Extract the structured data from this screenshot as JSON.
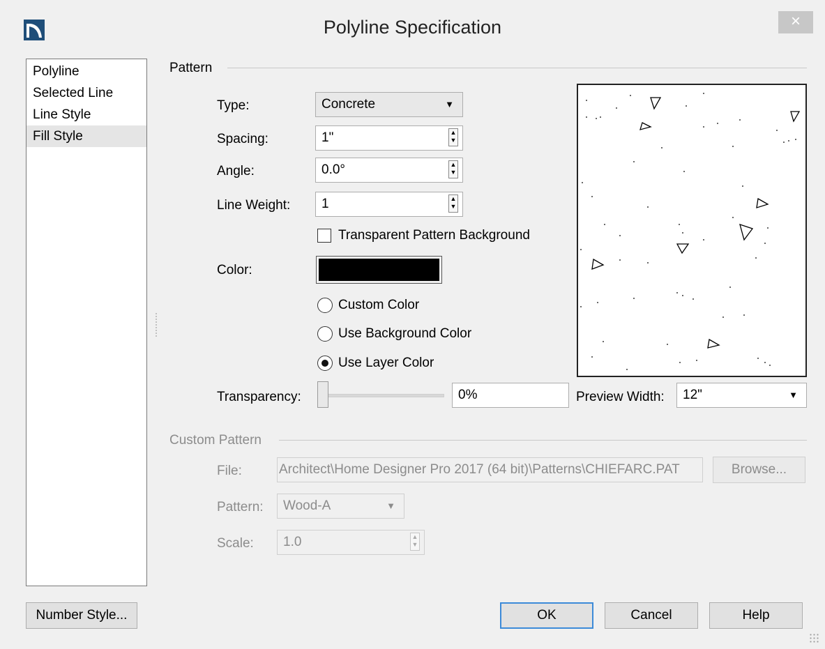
{
  "window": {
    "title": "Polyline Specification",
    "close_label": "×"
  },
  "nav": {
    "items": [
      {
        "label": "Polyline"
      },
      {
        "label": "Selected Line"
      },
      {
        "label": "Line Style"
      },
      {
        "label": "Fill Style",
        "selected": true
      }
    ]
  },
  "pattern": {
    "section_label": "Pattern",
    "type_label": "Type:",
    "type_value": "Concrete",
    "spacing_label": "Spacing:",
    "spacing_value": "1\"",
    "angle_label": "Angle:",
    "angle_value": "0.0°",
    "line_weight_label": "Line Weight:",
    "line_weight_value": "1",
    "transparent_bg_label": "Transparent Pattern Background",
    "transparent_bg_checked": false,
    "color_label": "Color:",
    "color_value": "#000000",
    "radio_custom_label": "Custom Color",
    "radio_background_label": "Use Background Color",
    "radio_layer_label": "Use Layer Color",
    "selected_color_option": "Use Layer Color",
    "transparency_label": "Transparency:",
    "transparency_value": "0%",
    "transparency_level": 0,
    "preview_width_label": "Preview Width:",
    "preview_width_value": "12\""
  },
  "custom_pattern": {
    "section_label": "Custom Pattern",
    "file_label": "File:",
    "file_value": "Architect\\Home Designer Pro 2017 (64 bit)\\Patterns\\CHIEFARC.PAT",
    "browse_label": "Browse...",
    "pattern_label": "Pattern:",
    "pattern_value": "Wood-A",
    "scale_label": "Scale:",
    "scale_value": "1.0"
  },
  "footer": {
    "number_style_label": "Number Style...",
    "ok_label": "OK",
    "cancel_label": "Cancel",
    "help_label": "Help"
  },
  "icons": {
    "app": "chief-architect-logo-icon",
    "close": "close-icon",
    "dropdown": "chevron-down-icon",
    "spinner": "spinner-arrows-icon"
  }
}
